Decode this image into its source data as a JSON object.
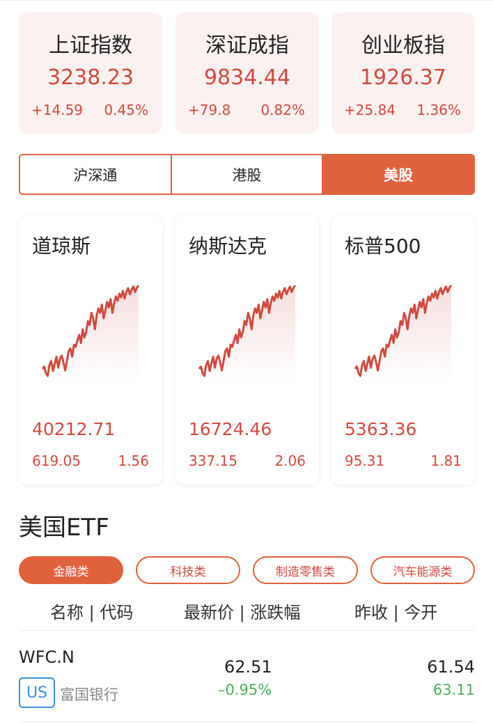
{
  "indices": [
    {
      "name": "上证指数",
      "value": "3238.23",
      "change": "+14.59",
      "percent": "0.45%"
    },
    {
      "name": "深证成指",
      "value": "9834.44",
      "change": "+79.8",
      "percent": "0.82%"
    },
    {
      "name": "创业板指",
      "value": "1926.37",
      "change": "+25.84",
      "percent": "1.36%"
    }
  ],
  "tabs": [
    {
      "label": "沪深通",
      "active": false
    },
    {
      "label": "港股",
      "active": false
    },
    {
      "label": "美股",
      "active": true
    }
  ],
  "us_indices": [
    {
      "name": "道琼斯",
      "value": "40212.71",
      "change": "619.05",
      "percent": "1.56"
    },
    {
      "name": "纳斯达克",
      "value": "16724.46",
      "change": "337.15",
      "percent": "2.06"
    },
    {
      "name": "标普500",
      "value": "5363.36",
      "change": "95.31",
      "percent": "1.81"
    }
  ],
  "sparkline": [
    48,
    52,
    40,
    35,
    55,
    62,
    44,
    58,
    70,
    50,
    66,
    72,
    60,
    45,
    62,
    80,
    85,
    70,
    92,
    88,
    100,
    110,
    95,
    120,
    105,
    115,
    135,
    128,
    150,
    140,
    120,
    145,
    158,
    150,
    165,
    140,
    155,
    170,
    160,
    175,
    150,
    168,
    180,
    172,
    185,
    178,
    190,
    176,
    188,
    195,
    184,
    192,
    198,
    188,
    196,
    200
  ],
  "etf": {
    "title": "美国ETF",
    "categories": [
      {
        "label": "金融类",
        "active": true
      },
      {
        "label": "科技类",
        "active": false
      },
      {
        "label": "制造零售类",
        "active": false
      },
      {
        "label": "汽车能源类",
        "active": false
      }
    ],
    "headers": [
      "名称 | 代码",
      "最新价 | 涨跌幅",
      "昨收 | 今开"
    ],
    "rows": [
      {
        "code": "WFC.N",
        "market": "US",
        "name": "富国银行",
        "price": "62.51",
        "change_pct": "–0.95%",
        "prev_close": "61.54",
        "open": "63.11"
      }
    ]
  },
  "colors": {
    "accent": "#e0623d",
    "up": "#d04a3f",
    "down": "#4fad5b",
    "badge": "#3d8fe0"
  }
}
